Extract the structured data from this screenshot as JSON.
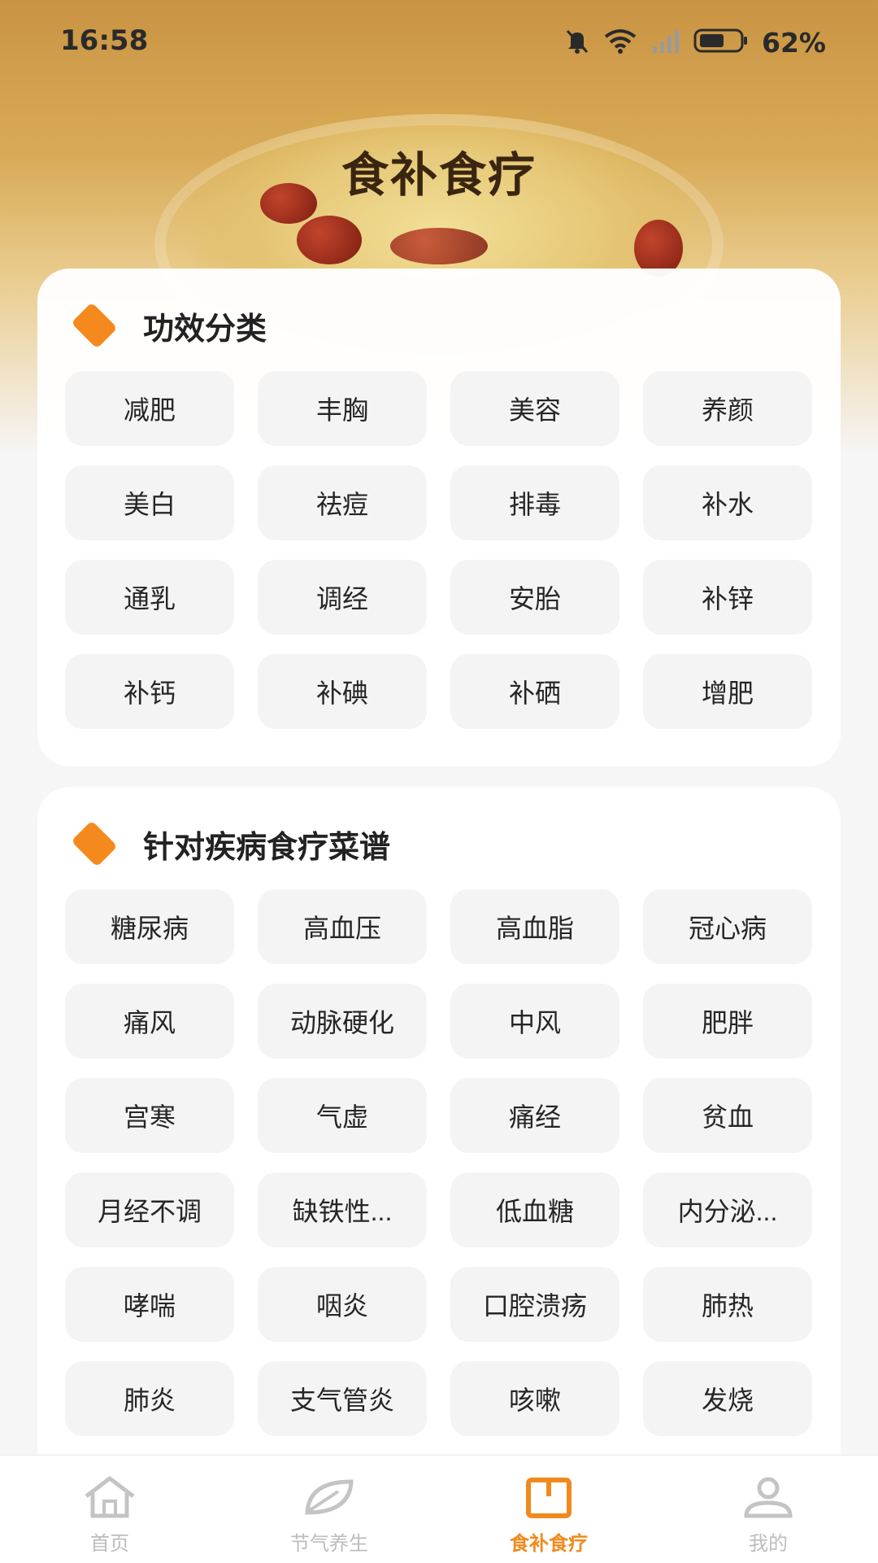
{
  "status_bar": {
    "time": "16:58",
    "battery_percent": "62%",
    "battery_level": 0.62,
    "icons": [
      "mute-bell-icon",
      "wifi-icon",
      "signal-icon",
      "battery-icon"
    ]
  },
  "header": {
    "title": "食补食疗"
  },
  "efficacy_section": {
    "title": "功效分类",
    "items": [
      "减肥",
      "丰胸",
      "美容",
      "养颜",
      "美白",
      "祛痘",
      "排毒",
      "补水",
      "通乳",
      "调经",
      "安胎",
      "补锌",
      "补钙",
      "补碘",
      "补硒",
      "增肥"
    ]
  },
  "disease_section": {
    "title": "针对疾病食疗菜谱",
    "items": [
      "糖尿病",
      "高血压",
      "高血脂",
      "冠心病",
      "痛风",
      "动脉硬化",
      "中风",
      "肥胖",
      "宫寒",
      "气虚",
      "痛经",
      "贫血",
      "月经不调",
      "缺铁性...",
      "低血糖",
      "内分泌...",
      "哮喘",
      "咽炎",
      "口腔溃疡",
      "肺热",
      "肺炎",
      "支气管炎",
      "咳嗽",
      "发烧"
    ]
  },
  "tab_bar": {
    "tabs": [
      {
        "label": "首页",
        "icon": "home-icon",
        "active": false
      },
      {
        "label": "节气养生",
        "icon": "leaf-icon",
        "active": false
      },
      {
        "label": "食补食疗",
        "icon": "book-icon",
        "active": true
      },
      {
        "label": "我的",
        "icon": "profile-icon",
        "active": false
      }
    ]
  },
  "colors": {
    "accent": "#f08a1c",
    "diamond": "#f48a1e",
    "chip_bg": "#f4f4f4",
    "inactive_tab": "#bdbdbd"
  }
}
